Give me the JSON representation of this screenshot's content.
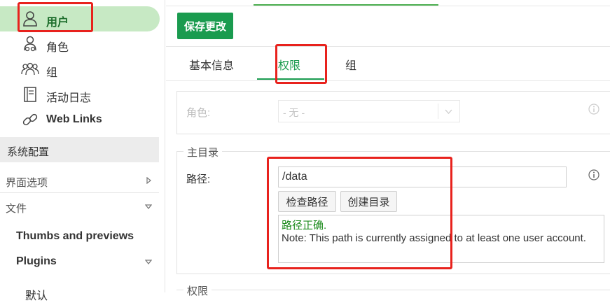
{
  "sidebar": {
    "items": [
      {
        "label": "用户",
        "icon": "user-icon",
        "active": true
      },
      {
        "label": "角色",
        "icon": "role-icon"
      },
      {
        "label": "组",
        "icon": "group-icon"
      },
      {
        "label": "活动日志",
        "icon": "log-book-icon"
      },
      {
        "label": "Web Links",
        "icon": "link-icon"
      }
    ],
    "section_title": "系统配置",
    "rows": [
      {
        "label": "界面选项",
        "icon": "chevron-right-icon"
      },
      {
        "label": "文件",
        "icon": "chevron-down-icon"
      }
    ],
    "sub_items": [
      {
        "label": "Thumbs and previews"
      },
      {
        "label": "Plugins",
        "icon": "chevron-down-icon"
      },
      {
        "label": "默认"
      }
    ]
  },
  "toolbar": {
    "save_label": "保存更改"
  },
  "tabs": [
    {
      "label": "基本信息"
    },
    {
      "label": "权限",
      "active": true
    },
    {
      "label": "组"
    }
  ],
  "role": {
    "label": "角色:",
    "value": "- 无 -"
  },
  "home_dir": {
    "legend": "主目录",
    "path_label": "路径:",
    "path_value": "/data",
    "check_button": "检查路径",
    "create_button": "创建目录",
    "message_ok": "路径正确.",
    "message_note": "Note: This path is currently assigned to at least one user account."
  },
  "permissions_legend": "权限",
  "colors": {
    "accent": "#1a9b4f",
    "active_nav_bg": "#c7e9c4",
    "highlight": "#e8221d"
  }
}
